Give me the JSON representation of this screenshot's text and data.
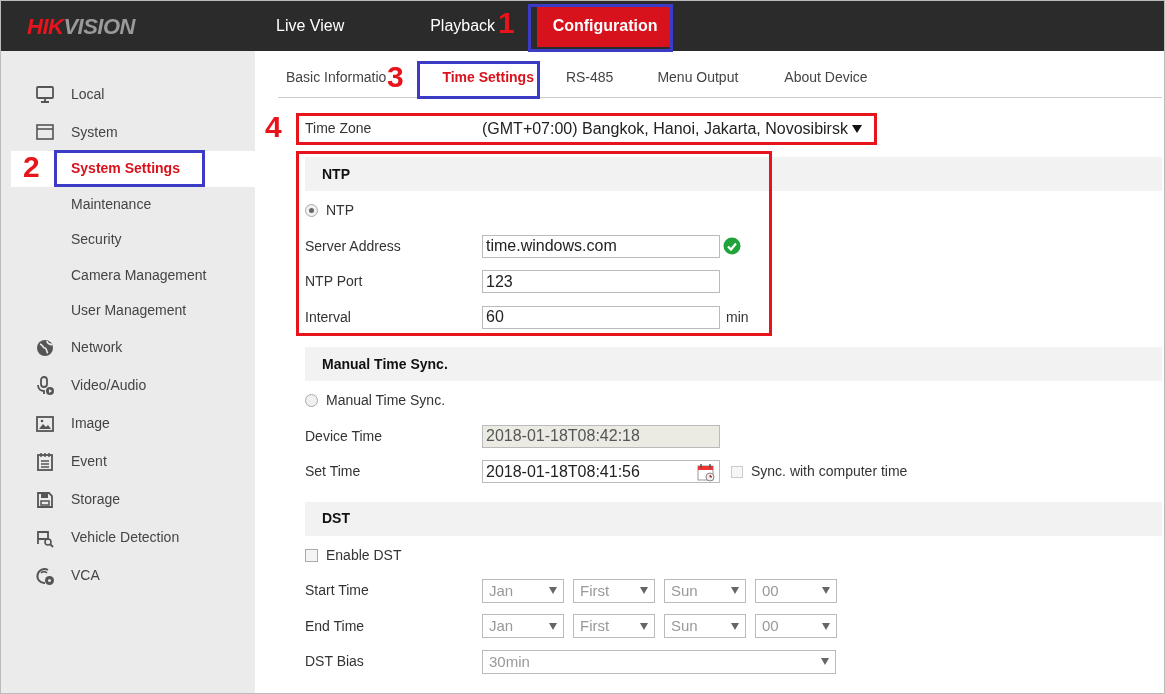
{
  "header": {
    "logo": "HIKVISION",
    "nav": [
      {
        "label": "Live View",
        "selected": false
      },
      {
        "label": "Playback",
        "selected": false
      },
      {
        "label": "Configuration",
        "selected": true
      }
    ]
  },
  "sidebar": {
    "items": [
      {
        "label": "Local",
        "selected": false
      },
      {
        "label": "System",
        "selected": false,
        "expanded": true,
        "children": [
          {
            "label": "System Settings",
            "selected": true
          },
          {
            "label": "Maintenance",
            "selected": false
          },
          {
            "label": "Security",
            "selected": false
          },
          {
            "label": "Camera Management",
            "selected": false
          },
          {
            "label": "User Management",
            "selected": false
          }
        ]
      },
      {
        "label": "Network",
        "selected": false
      },
      {
        "label": "Video/Audio",
        "selected": false
      },
      {
        "label": "Image",
        "selected": false
      },
      {
        "label": "Event",
        "selected": false
      },
      {
        "label": "Storage",
        "selected": false
      },
      {
        "label": "Vehicle Detection",
        "selected": false
      },
      {
        "label": "VCA",
        "selected": false
      }
    ]
  },
  "tabs": [
    {
      "label": "Basic Informatio",
      "selected": false
    },
    {
      "label": "Time Settings",
      "selected": true
    },
    {
      "label": "RS-485",
      "selected": false
    },
    {
      "label": "Menu Output",
      "selected": false
    },
    {
      "label": "About Device",
      "selected": false
    }
  ],
  "time_zone": {
    "label": "Time Zone",
    "value": "(GMT+07:00) Bangkok, Hanoi, Jakarta, Novosibirsk"
  },
  "sections": [
    {
      "title": "NTP",
      "rows": [
        {
          "kind": "radio",
          "label": "NTP",
          "selected": true
        },
        {
          "kind": "input",
          "label": "Server Address",
          "value": "time.windows.com",
          "valid": true
        },
        {
          "kind": "input",
          "label": "NTP Port",
          "value": "123"
        },
        {
          "kind": "input",
          "label": "Interval",
          "value": "60",
          "unit": "min"
        }
      ]
    },
    {
      "title": "Manual Time Sync.",
      "rows": [
        {
          "kind": "radio",
          "label": "Manual Time Sync.",
          "selected": false
        },
        {
          "kind": "input",
          "label": "Device Time",
          "value": "2018-01-18T08:42:18",
          "disabled": true
        },
        {
          "kind": "datetime",
          "label": "Set Time",
          "value": "2018-01-18T08:41:56",
          "checkbox": {
            "label": "Sync. with computer time",
            "checked": false
          }
        }
      ]
    },
    {
      "title": "DST",
      "rows": [
        {
          "kind": "checkbox",
          "label": "Enable DST",
          "checked": false
        },
        {
          "kind": "selects",
          "label": "Start Time",
          "values": [
            "Jan",
            "First",
            "Sun",
            "00"
          ],
          "disabled": true
        },
        {
          "kind": "selects",
          "label": "End Time",
          "values": [
            "Jan",
            "First",
            "Sun",
            "00"
          ],
          "disabled": true
        },
        {
          "kind": "select",
          "label": "DST Bias",
          "value": "30min",
          "disabled": true
        }
      ]
    }
  ],
  "annotations": [
    {
      "label": "1",
      "color": "#e8141c"
    },
    {
      "label": "2",
      "color": "#e8141c"
    },
    {
      "label": "3",
      "color": "#e8141c"
    },
    {
      "label": "4",
      "color": "#e8141c"
    }
  ],
  "highlight_boxes": [
    {
      "color": "#3b3bc6"
    },
    {
      "color": "#3b3bc6"
    },
    {
      "color": "#3b3bc6"
    },
    {
      "color": "#e8141c"
    },
    {
      "color": "#e8141c"
    }
  ]
}
